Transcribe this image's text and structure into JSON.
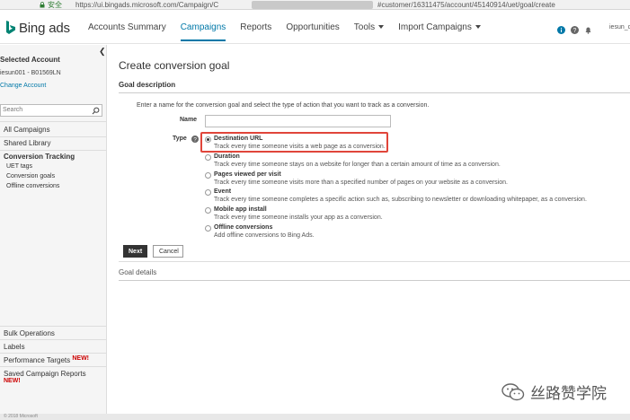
{
  "browser": {
    "secure_label": "安全",
    "url_prefix": "https://ui.bingads.microsoft.com/Campaign/C",
    "url_suffix": "#customer/16311475/account/45140914/uet/goal/create"
  },
  "header": {
    "brand": "Bing ads",
    "nav": [
      {
        "label": "Accounts Summary"
      },
      {
        "label": "Campaigns"
      },
      {
        "label": "Reports"
      },
      {
        "label": "Opportunities"
      },
      {
        "label": "Tools"
      },
      {
        "label": "Import Campaigns"
      }
    ],
    "user": "iesun_c"
  },
  "sidebar": {
    "selected_account_label": "Selected Account",
    "account_value": "iesun001 - B01569LN",
    "change_account": "Change Account",
    "search_placeholder": "Search",
    "items": [
      {
        "label": "All Campaigns"
      },
      {
        "label": "Shared Library"
      },
      {
        "label": "Conversion Tracking"
      },
      {
        "label": "UET tags"
      },
      {
        "label": "Conversion goals"
      },
      {
        "label": "Offline conversions"
      }
    ],
    "bottom_items": [
      {
        "label": "Bulk Operations"
      },
      {
        "label": "Labels"
      },
      {
        "label": "Performance Targets"
      },
      {
        "label": "Saved Campaign Reports"
      }
    ],
    "new_badge": "NEW!"
  },
  "main": {
    "title": "Create conversion goal",
    "section1": "Goal description",
    "intro": "Enter a name for the conversion goal and select the type of action that you want to track as a conversion.",
    "name_label": "Name",
    "name_value": "",
    "type_label": "Type",
    "options": [
      {
        "title": "Destination URL",
        "desc": "Track every time someone visits a web page as a conversion.",
        "selected": true
      },
      {
        "title": "Duration",
        "desc": "Track every time someone stays on a website for longer than a certain amount of time as a conversion.",
        "selected": false
      },
      {
        "title": "Pages viewed per visit",
        "desc": "Track every time someone visits more than a specified number of pages on your website as a conversion.",
        "selected": false
      },
      {
        "title": "Event",
        "desc": "Track every time someone completes a specific action such as, subscribing to newsletter or downloading whitepaper, as a conversion.",
        "selected": false
      },
      {
        "title": "Mobile app install",
        "desc": "Track every time someone installs your app as a conversion.",
        "selected": false
      },
      {
        "title": "Offline conversions",
        "desc": "Add offline conversions to Bing Ads.",
        "selected": false
      }
    ],
    "next_label": "Next",
    "cancel_label": "Cancel",
    "section2": "Goal details"
  },
  "watermark": "丝路赞学院",
  "footer": "© 2018 Microsoft"
}
